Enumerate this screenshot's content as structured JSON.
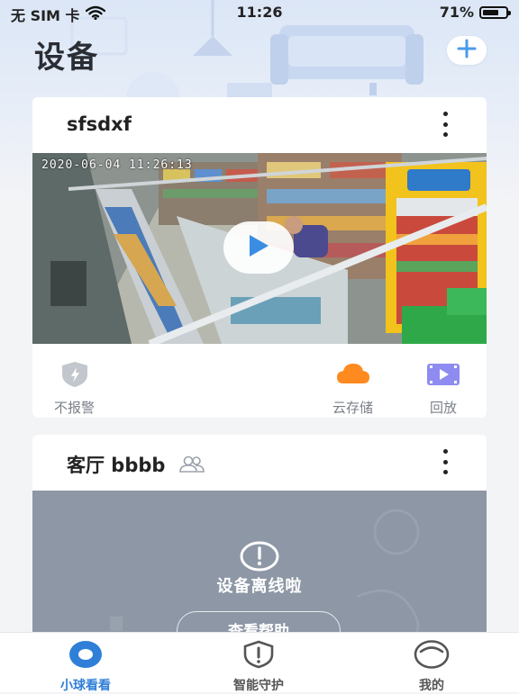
{
  "status_bar": {
    "carrier": "无 SIM 卡",
    "time": "11:26",
    "battery_text": "71%",
    "battery_level": 0.71
  },
  "header": {
    "title": "设备"
  },
  "devices": [
    {
      "name": "sfsdxf",
      "osd_timestamp": "2020-06-04  11:26:13",
      "actions": [
        {
          "label": "不报警",
          "icon": "shield-icon"
        },
        {
          "label": "云存储",
          "icon": "cloud-icon"
        },
        {
          "label": "回放",
          "icon": "playback-icon"
        }
      ]
    },
    {
      "name": "客厅 bbbb",
      "shared_icon": "shared-users-icon",
      "offline_message": "设备离线啦",
      "help_button": "查看帮助"
    }
  ],
  "tabbar": {
    "tabs": [
      {
        "label": "小球看看",
        "icon": "camera-ball-icon",
        "active": true
      },
      {
        "label": "智能守护",
        "icon": "guard-shield-icon",
        "active": false
      },
      {
        "label": "我的",
        "icon": "profile-face-icon",
        "active": false
      }
    ]
  },
  "colors": {
    "accent": "#2f7fd8",
    "cloud_orange": "#ff8a1f",
    "playback_purple": "#8e8cf0",
    "offline_bg": "#8d97a5"
  }
}
